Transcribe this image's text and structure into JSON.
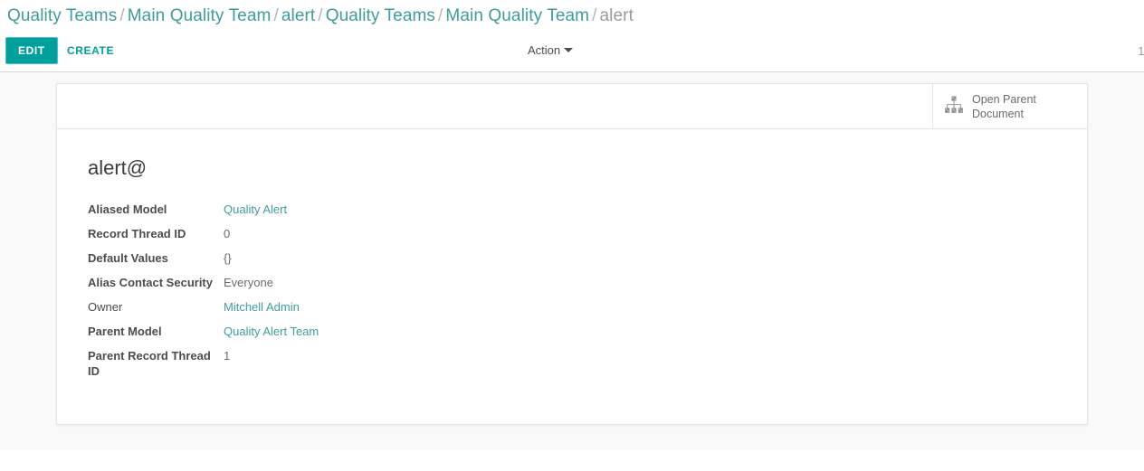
{
  "breadcrumb": {
    "separator": "/",
    "items": [
      {
        "label": "Quality Teams",
        "active": false
      },
      {
        "label": "Main Quality Team",
        "active": false
      },
      {
        "label": "alert",
        "active": false
      },
      {
        "label": "Quality Teams",
        "active": false
      },
      {
        "label": "Main Quality Team",
        "active": false
      },
      {
        "label": "alert",
        "active": true
      }
    ]
  },
  "control_panel": {
    "edit_label": "EDIT",
    "create_label": "CREATE",
    "action_label": "Action",
    "pager": {
      "current": "1",
      "separator": "/"
    }
  },
  "sheet": {
    "stat_button": {
      "label": "Open Parent Document",
      "icon": "sitemap-icon"
    },
    "record_title": "alert@",
    "fields": [
      {
        "label": "Aliased Model",
        "value": "Quality Alert",
        "is_link": true,
        "bold": true
      },
      {
        "label": "Record Thread ID",
        "value": "0",
        "is_link": false,
        "bold": true
      },
      {
        "label": "Default Values",
        "value": "{}",
        "is_link": false,
        "bold": true
      },
      {
        "label": "Alias Contact Security",
        "value": "Everyone",
        "is_link": false,
        "bold": true
      },
      {
        "label": "Owner",
        "value": "Mitchell Admin",
        "is_link": true,
        "bold": false
      },
      {
        "label": "Parent Model",
        "value": "Quality Alert Team",
        "is_link": true,
        "bold": true
      },
      {
        "label": "Parent Record Thread ID",
        "value": "1",
        "is_link": false,
        "bold": true
      }
    ]
  },
  "colors": {
    "accent": "#00a09d",
    "link": "#3f9c9c",
    "text": "#4c4c4c",
    "muted": "#9a9a9a",
    "body_bg": "#f9f9f9",
    "sheet_bg": "#ffffff",
    "border": "#e3e3e3"
  }
}
